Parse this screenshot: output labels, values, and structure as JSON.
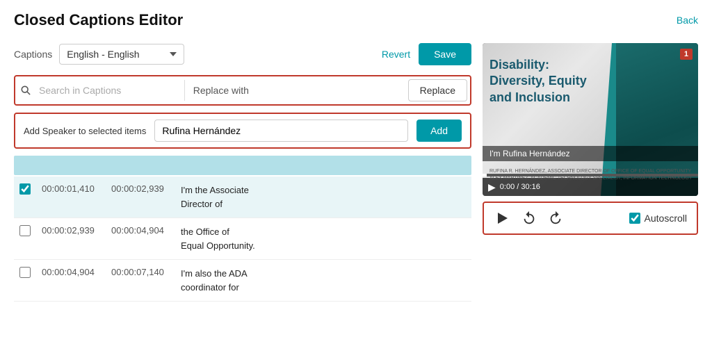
{
  "header": {
    "title": "Closed Captions Editor",
    "back_label": "Back"
  },
  "captions_row": {
    "label": "Captions",
    "select_value": "English - English",
    "revert_label": "Revert",
    "save_label": "Save"
  },
  "search": {
    "placeholder": "Search in Captions",
    "replace_label": "Replace with",
    "replace_btn": "Replace"
  },
  "add_speaker": {
    "label": "Add Speaker to selected items",
    "value": "Rufina Hernández",
    "btn_label": "Add"
  },
  "caption_rows": [
    {
      "selected": true,
      "start": "00:00:01,410",
      "end": "00:00:02,939",
      "text": "I'm the Associate\nDirector of"
    },
    {
      "selected": false,
      "start": "00:00:02,939",
      "end": "00:00:04,904",
      "text": "the Office of\nEqual Opportunity."
    },
    {
      "selected": false,
      "start": "00:00:04,904",
      "end": "00:00:07,140",
      "text": "I'm also the ADA\ncoordinator for"
    }
  ],
  "video": {
    "slide_title": "Disability:\nDiversity, Equity\nand Inclusion",
    "overlay_text": "I'm Rufina Hernández",
    "credit1": "RUFINA R. HERNÁNDEZ, ASSOCIATE DIRECTOR OF OFFICE OF EQUAL OPPORTUNITY",
    "credit2": "ALEX MARTINEZ, ACADEMIC TECHNOLOGY SPECIALIST, INFORMATION TECHNOLOGY",
    "red_badge": "1",
    "time_current": "0:00",
    "time_total": "30:16"
  },
  "autoscroll": {
    "label": "Autoscroll"
  }
}
